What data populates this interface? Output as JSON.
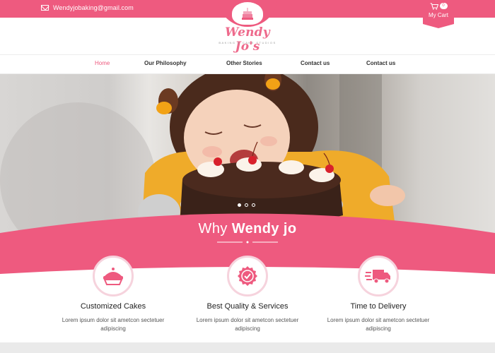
{
  "topbar": {
    "email": "Wendyjobaking@gmail.com",
    "cart_label": "My Cart",
    "cart_count": "0"
  },
  "logo": {
    "title": "Wendy Jo's",
    "subtitle": "BAKING & CAKE STUDIOS"
  },
  "nav": {
    "items": [
      {
        "label": "Home",
        "active": true
      },
      {
        "label": "Our Philosophy"
      },
      {
        "label": "Other Stories"
      },
      {
        "label": "Contact us"
      },
      {
        "label": "Contact us"
      }
    ]
  },
  "hero": {
    "slides": 3,
    "active_slide": 1
  },
  "why": {
    "title_prefix": "Why ",
    "title_bold": "Wendy jo"
  },
  "features": [
    {
      "icon": "cake-icon",
      "title": "Customized Cakes",
      "desc": "Lorem ipsum dolor sit ametcon sectetuer adipiscing"
    },
    {
      "icon": "badge-check-icon",
      "title": "Best Quality & Services",
      "desc": "Lorem ipsum dolor sit ametcon sectetuer adipiscing"
    },
    {
      "icon": "delivery-truck-icon",
      "title": "Time to Delivery",
      "desc": "Lorem ipsum dolor sit ametcon sectetuer adipiscing"
    }
  ],
  "colors": {
    "brand_pink": "#ee5a7f",
    "light_pink": "#f6d3dd",
    "text_dark": "#222222"
  }
}
